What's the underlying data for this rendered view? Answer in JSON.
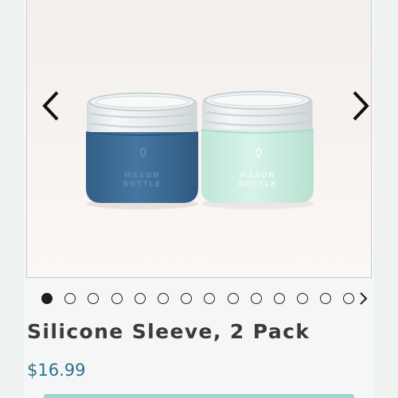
{
  "product": {
    "title": "Silicone Sleeve, 2 Pack",
    "price": "$16.99",
    "image": {
      "description": "Two glass mason jars with silicone sleeves: blue and mint",
      "sleeve_colors": [
        "#3f6f98",
        "#cfeee3"
      ],
      "sleeve_text": "MASON BOTTLE"
    }
  },
  "gallery": {
    "prev_icon": "chevron-left-icon",
    "next_icon": "chevron-right-icon",
    "active_index": 0,
    "dot_count": 14,
    "dots_next_icon": "chevron-right-icon"
  }
}
